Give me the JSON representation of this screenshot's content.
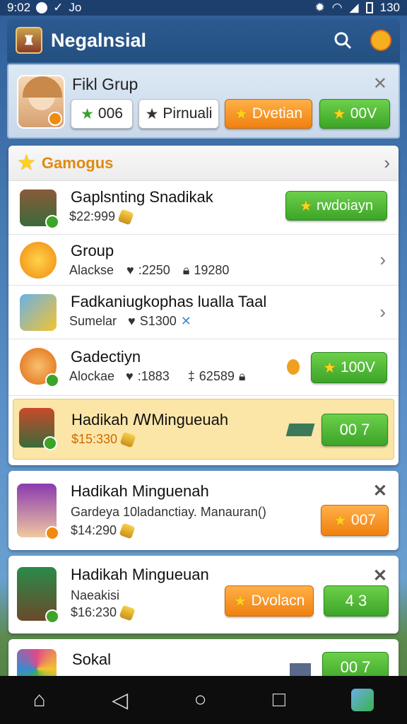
{
  "status": {
    "time": "9:02",
    "extra": "Jo",
    "battery": "130"
  },
  "app": {
    "title": "Negalnsial"
  },
  "profile": {
    "name": "Fikl Grup",
    "pill1": "006",
    "pill2": "Pirnuali",
    "pill3": "Dvetian",
    "pill4": "00V"
  },
  "section": {
    "title": "Gamogus",
    "items": [
      {
        "name": "Gaplsnting Snadikak",
        "price": "$22:999",
        "action": "rwdoiayn"
      },
      {
        "name": "Group",
        "meta1": "Alackse",
        "meta2": ":2250",
        "meta3": "19280"
      },
      {
        "name": "Fadkaniugkophas lualla Taal",
        "meta1": "Sumelar",
        "meta2": "S1300"
      },
      {
        "name": "Gadectiyn",
        "meta1": "Alockae",
        "meta2": ":1883",
        "meta3": "62589",
        "action": "100V"
      },
      {
        "name": "Hadikah ꟿMingueuah",
        "price": "$15:330",
        "action": "00 7"
      }
    ]
  },
  "cards": [
    {
      "name": "Hadikah Minguenah",
      "sub": "Gardeya 10ladanctiay. Manauran()",
      "price": "$14:290",
      "action": "007"
    },
    {
      "name": "Hadikah Mingueuan",
      "sub": "Naeakisi",
      "price": "$16:230",
      "action_orange": "Dvolacn",
      "action_green": "4 3"
    },
    {
      "name": "Sokal",
      "action": "00 7"
    }
  ]
}
